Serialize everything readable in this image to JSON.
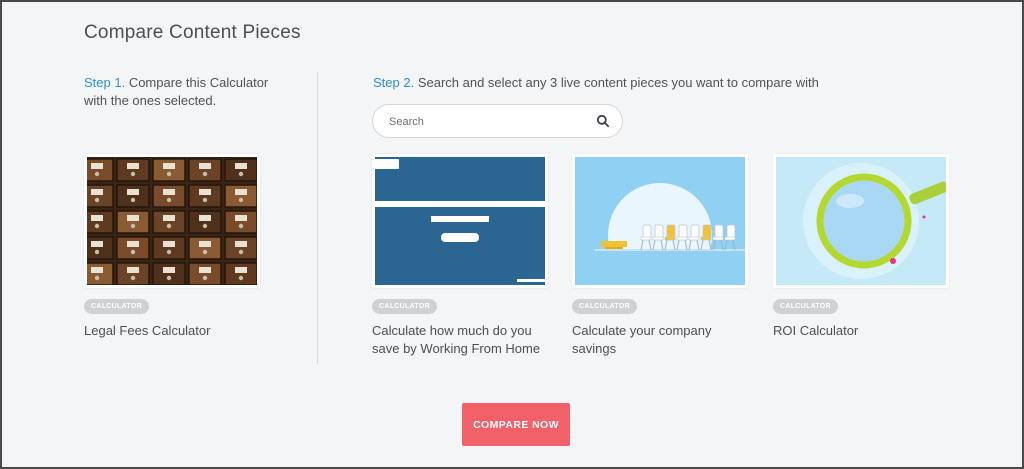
{
  "page": {
    "title": "Compare Content Pieces"
  },
  "step1": {
    "number": "Step 1.",
    "text": " Compare this Calculator with the ones selected."
  },
  "step2": {
    "number": "Step 2.",
    "text": " Search and select any 3 live content pieces you want to compare with"
  },
  "search": {
    "placeholder": "Search",
    "value": "",
    "icon": "search-icon"
  },
  "cards": [
    {
      "badge": "CALCULATOR",
      "title": "Legal Fees Calculator",
      "thumbnail": "card-catalog-drawers"
    },
    {
      "badge": "CALCULATOR",
      "title": "Calculate how much do you save by Working From Home",
      "thumbnail": "blue-page-mockup"
    },
    {
      "badge": "CALCULATOR",
      "title": "Calculate your company savings",
      "thumbnail": "chairs-sunrise-illustration"
    },
    {
      "badge": "CALCULATOR",
      "title": "ROI Calculator",
      "thumbnail": "magnifying-glass-illustration"
    }
  ],
  "actions": {
    "compare_label": "COMPARE NOW"
  },
  "colors": {
    "accent_step": "#2f8fd0",
    "compare_button": "#f2606a",
    "badge": "#cfd2d5",
    "background": "#f4f5f7"
  }
}
